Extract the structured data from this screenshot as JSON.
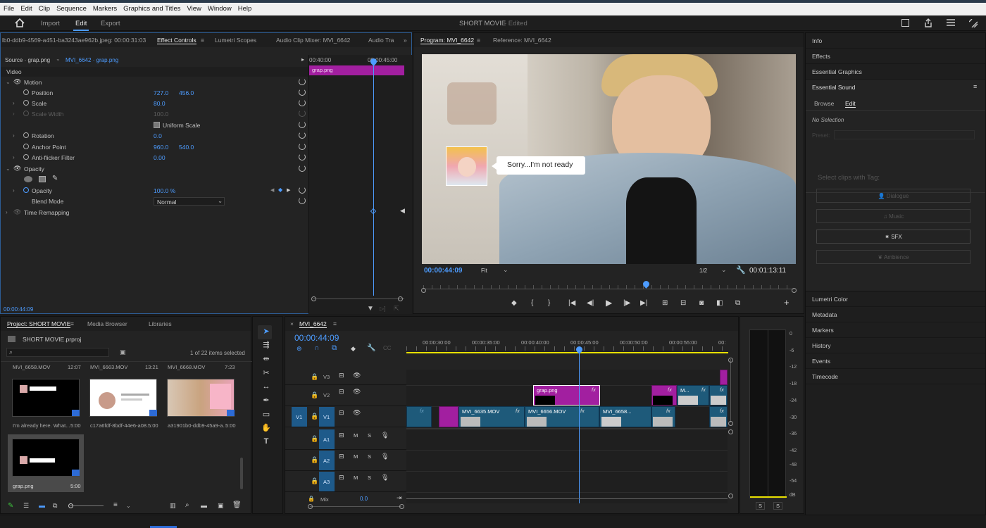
{
  "menu": [
    "File",
    "Edit",
    "Clip",
    "Sequence",
    "Markers",
    "Graphics and Titles",
    "View",
    "Window",
    "Help"
  ],
  "workspace_tabs": [
    "Import",
    "Edit",
    "Export"
  ],
  "app_title": "SHORT MOVIE",
  "app_status": "- Edited",
  "effect_controls": {
    "left_title": "lb0-ddb9-4569-a451-ba3243ae962b.jpeg: 00:00:31:03",
    "tabs": [
      "Effect Controls",
      "Lumetri Scopes",
      "Audio Clip Mixer: MVI_6642",
      "Audio Tra"
    ],
    "source": "Source · grap.png",
    "sequence_clip": "MVI_6642 · grap.png",
    "ruler": [
      "00:40:00",
      "00:00:45:00"
    ],
    "clip_name": "grap.png",
    "section": "Video",
    "motion": "Motion",
    "position_label": "Position",
    "position_x": "727.0",
    "position_y": "456.0",
    "scale_label": "Scale",
    "scale_value": "80.0",
    "scale_width_label": "Scale Width",
    "scale_width_value": "100.0",
    "uniform_scale": "Uniform Scale",
    "rotation_label": "Rotation",
    "rotation_value": "0.0",
    "anchor_label": "Anchor Point",
    "anchor_x": "960.0",
    "anchor_y": "540.0",
    "antiflicker_label": "Anti-flicker Filter",
    "antiflicker_value": "0.00",
    "opacity_group": "Opacity",
    "opacity_label": "Opacity",
    "opacity_value": "100.0 %",
    "blend_label": "Blend Mode",
    "blend_value": "Normal",
    "time_remap": "Time Remapping",
    "timecode": "00:00:44:09"
  },
  "program": {
    "tab": "Program: MVI_6642",
    "reference": "Reference: MVI_6642",
    "bubble_text": "Sorry...I'm not ready",
    "timecode": "00:00:44:09",
    "fit": "Fit",
    "quality": "1/2",
    "duration": "00:01:13:11"
  },
  "right_panel": {
    "items_top": [
      "Info",
      "Effects",
      "Essential Graphics"
    ],
    "essential_sound": "Essential Sound",
    "sound_tabs": [
      "Browse",
      "Edit"
    ],
    "no_selection": "No Selection",
    "preset": "Preset:",
    "select_clips": "Select clips with Tag:",
    "tags": [
      "Dialogue",
      "Music",
      "SFX",
      "Ambience"
    ],
    "items_bottom": [
      "Lumetri Color",
      "Metadata",
      "Markers",
      "History",
      "Events",
      "Timecode"
    ]
  },
  "project": {
    "tabs": [
      "Project: SHORT MOVIE",
      "Media Browser",
      "Libraries"
    ],
    "file": "SHORT MOVIE.prproj",
    "selected": "1 of 22 items selected",
    "top_row": [
      {
        "name": "MVI_6658.MOV",
        "dur": "12:07"
      },
      {
        "name": "MVI_6663.MOV",
        "dur": "13:21"
      },
      {
        "name": "MVI_6668.MOV",
        "dur": "7:23"
      }
    ],
    "items": [
      {
        "name": "I'm already here. What...",
        "dur": "5:00"
      },
      {
        "name": "c17a6fdf-8bdf-44e6-a08...",
        "dur": "5:00"
      },
      {
        "name": "a31901b0-ddb9-45a9-a...",
        "dur": "5:00"
      },
      {
        "name": "grap.png",
        "dur": "5:00"
      }
    ]
  },
  "timeline": {
    "tab": "MVI_6642",
    "timecode": "00:00:44:09",
    "ruler": [
      "00:00:30:00",
      "00:00:35:00",
      "00:00:40:00",
      "00:00:45:00",
      "00:00:50:00",
      "00:00:55:00",
      "00:"
    ],
    "tracks_video": [
      "V3",
      "V2",
      "V1"
    ],
    "source_v": "V1",
    "tracks_audio": [
      "A1",
      "A2",
      "A3"
    ],
    "mix_label": "Mix",
    "mix_value": "0.0",
    "clips": [
      "grap.png",
      "MVI_6635.MOV",
      "MVI_6656.MOV",
      "MVI_6658...",
      "M..."
    ],
    "fx": "fx"
  },
  "meter": {
    "scale": [
      "0",
      "-6",
      "-12",
      "-18",
      "-24",
      "-30",
      "-36",
      "-42",
      "-48",
      "-54",
      "dB"
    ],
    "solo": [
      "S",
      "S"
    ]
  },
  "colors": {
    "accent": "#4d9cff",
    "pink": "#a21fa0",
    "clip_blue": "#1e5a7a",
    "yellow": "#e8e000"
  }
}
